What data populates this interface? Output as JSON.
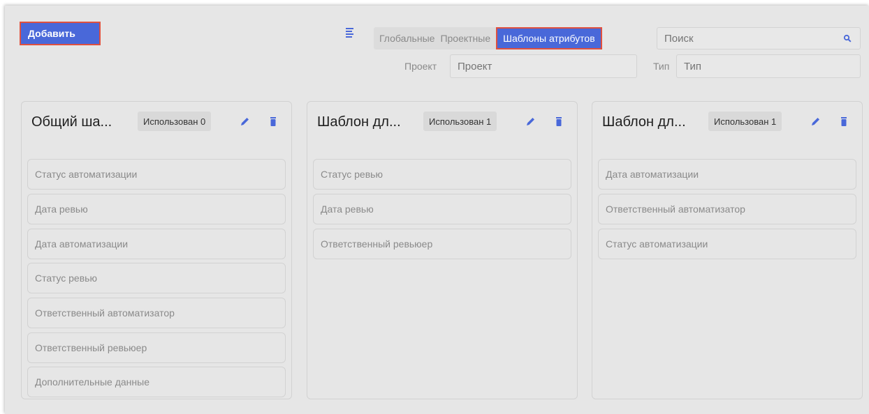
{
  "toolbar": {
    "add_label": "Добавить",
    "tabs": [
      {
        "label": "Глобальные"
      },
      {
        "label": "Проектные"
      },
      {
        "label": "Шаблоны атрибутов"
      }
    ],
    "search_placeholder": "Поиск"
  },
  "filters": {
    "project_label": "Проект",
    "project_placeholder": "Проект",
    "type_label": "Тип",
    "type_placeholder": "Тип"
  },
  "colors": {
    "accent": "#4968d9",
    "highlight_border": "#e0503e"
  },
  "templates": [
    {
      "title": "Общий ша...",
      "usage": "Использован 0",
      "attributes": [
        "Статус автоматизации",
        "Дата ревью",
        "Дата автоматизации",
        "Статус ревью",
        "Ответственный автоматизатор",
        "Ответственный ревьюер",
        "Дополнительные данные"
      ]
    },
    {
      "title": "Шаблон дл...",
      "usage": "Использован 1",
      "attributes": [
        "Статус ревью",
        "Дата ревью",
        "Ответственный ревьюер"
      ]
    },
    {
      "title": "Шаблон дл...",
      "usage": "Использован 1",
      "attributes": [
        "Дата автоматизации",
        "Ответственный автоматизатор",
        "Статус автоматизации"
      ]
    }
  ]
}
